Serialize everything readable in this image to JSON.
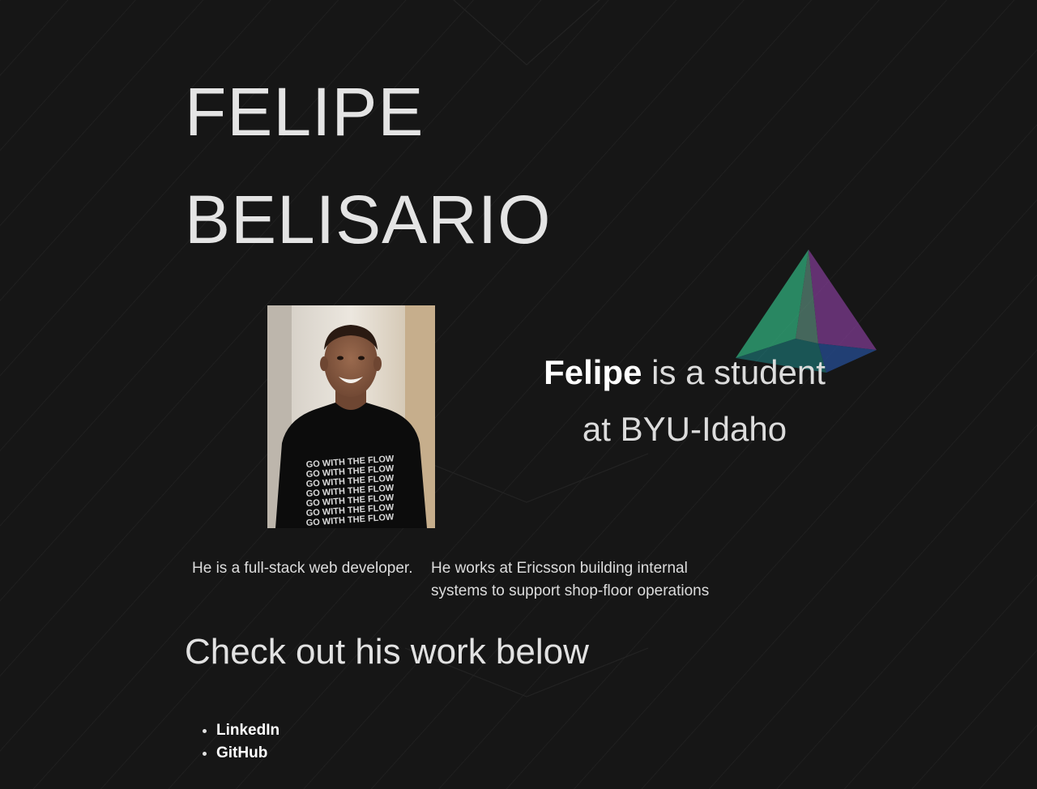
{
  "hero": {
    "title_line1": "FELIPE",
    "title_line2": "BELISARIO"
  },
  "profile": {
    "photo_alt": "Felipe smiling in a black GO WITH THE FLOW t-shirt",
    "intro_name": "Felipe",
    "intro_rest_line1": " is a student",
    "intro_rest_line2": "at BYU-Idaho"
  },
  "facts": [
    "He is a full-stack web developer.",
    "He works at Ericsson building internal systems to support shop-floor operations"
  ],
  "work": {
    "heading": "Check out his work below",
    "links": [
      {
        "label": "LinkedIn"
      },
      {
        "label": "GitHub"
      }
    ]
  },
  "colors": {
    "background": "#161616",
    "text": "#e2e2e2",
    "pyramid_green": "#2fa878",
    "pyramid_purple": "#7a3a8c",
    "pyramid_blue": "#244a8c"
  }
}
